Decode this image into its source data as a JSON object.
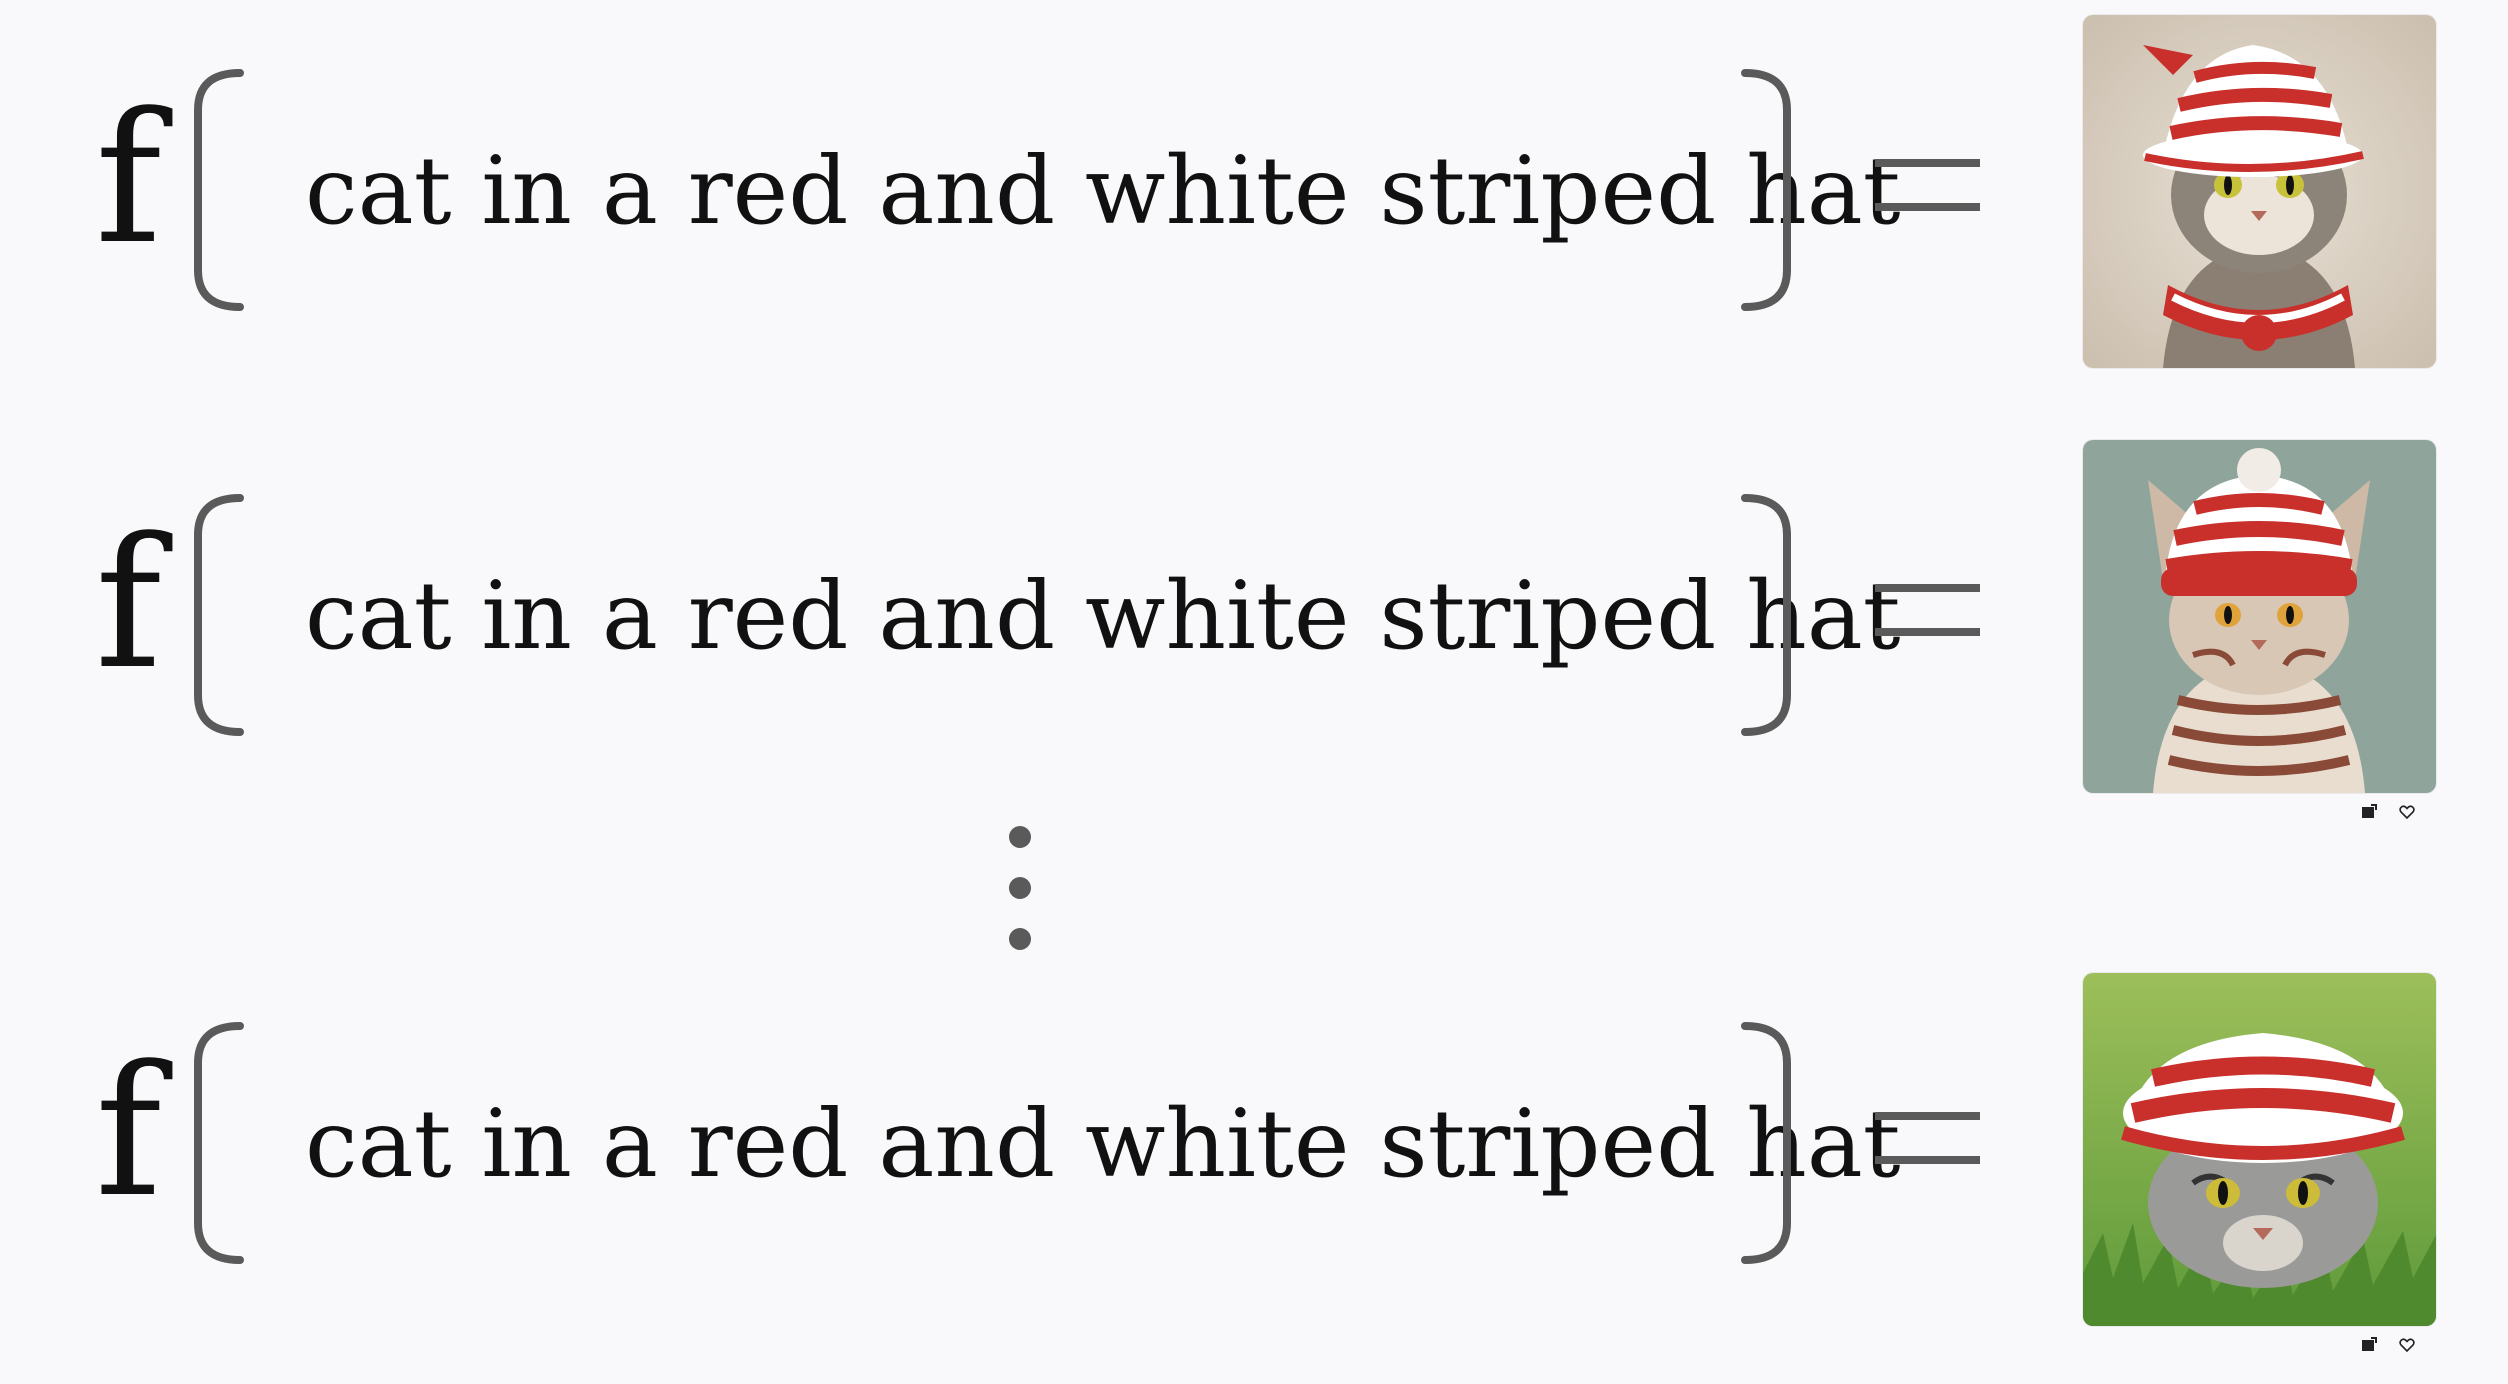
{
  "function_symbol": "f",
  "rows": [
    {
      "prompt": "cat in a red and white striped hat",
      "image_description": "cat-wearing-striped-hat-beige-background"
    },
    {
      "prompt": "cat in a red and white striped hat",
      "image_description": "cat-wearing-striped-beanie-teal-background"
    },
    {
      "prompt": "cat in a red and white striped hat",
      "image_description": "cat-wearing-striped-cap-on-grass"
    }
  ],
  "ellipsis": "vertical-dots",
  "colors": {
    "bracket": "#5a5a5a",
    "text": "#111111",
    "background": "#f9f9fb",
    "stripe_red": "#c9302c"
  },
  "icons": [
    "image-action-icon",
    "heart-icon"
  ]
}
